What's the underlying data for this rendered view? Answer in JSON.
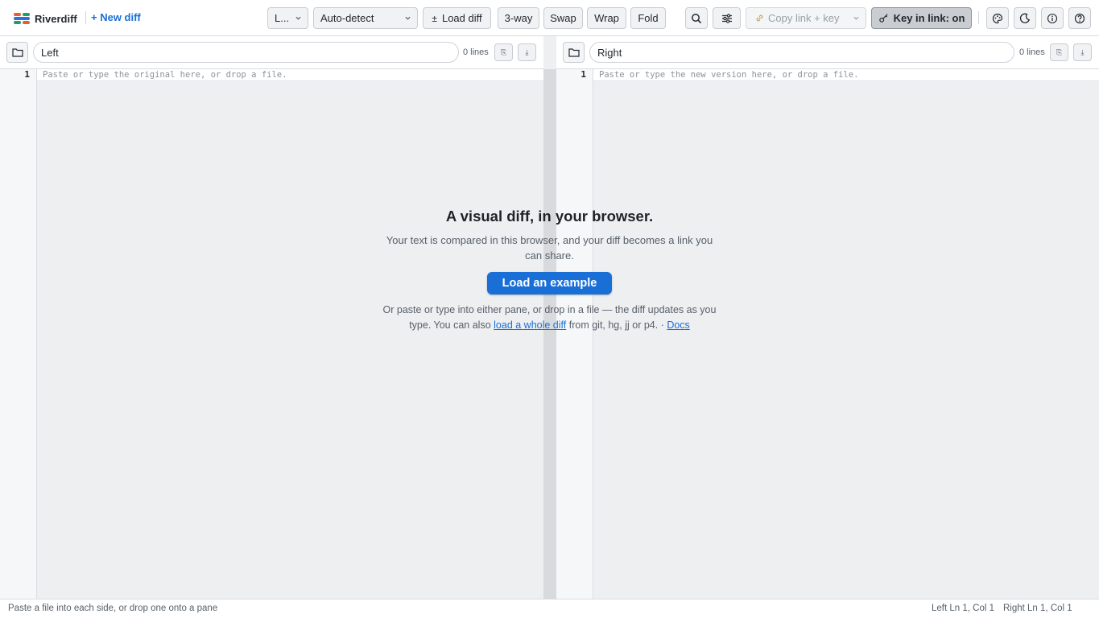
{
  "app": {
    "name": "Riverdiff",
    "new_diff_label": "+ New diff",
    "logo_colors": [
      "#e0612f",
      "#1f9d6a",
      "#2f6fd8"
    ]
  },
  "toolbar": {
    "layout_select": "L...",
    "language_select": "Auto-detect",
    "load_diff_label": "Load diff",
    "three_way_label": "3-way",
    "swap_label": "Swap",
    "wrap_label": "Wrap",
    "fold_label": "Fold",
    "copy_link_label": "Copy link + key",
    "key_in_link_label": "Key in link: on",
    "icons": [
      "search-icon",
      "sliders-icon",
      "link-icon",
      "key-icon",
      "palette-icon",
      "moon-icon",
      "info-icon",
      "help-icon"
    ]
  },
  "left": {
    "name_value": "Left",
    "line_count": "0 lines",
    "line_number": "1",
    "placeholder": "Paste or type the original here, or drop a file."
  },
  "right": {
    "name_value": "Right",
    "line_count": "0 lines",
    "line_number": "1",
    "placeholder": "Paste or type the new version here, or drop a file."
  },
  "welcome": {
    "title": "A visual diff, in your browser.",
    "subtitle": "Your text is compared in this browser, and your diff becomes a link you can share.",
    "example_button": "Load an example",
    "hint_before": "Or paste or type into either pane, or drop in a file — the diff updates as you type. You can also ",
    "hint_link": "load a whole diff",
    "hint_middle": " from git, hg, jj or p4. · ",
    "docs_link": "Docs"
  },
  "status": {
    "left_text": "Paste a file into each side, or drop one onto a pane",
    "left_cursor": "Left Ln 1, Col 1",
    "right_cursor": "Right Ln 1, Col 1"
  },
  "colors": {
    "accent": "#1a6fd6",
    "editor_bg": "#eeeff1",
    "active_toggle": "#c9ccd1"
  }
}
